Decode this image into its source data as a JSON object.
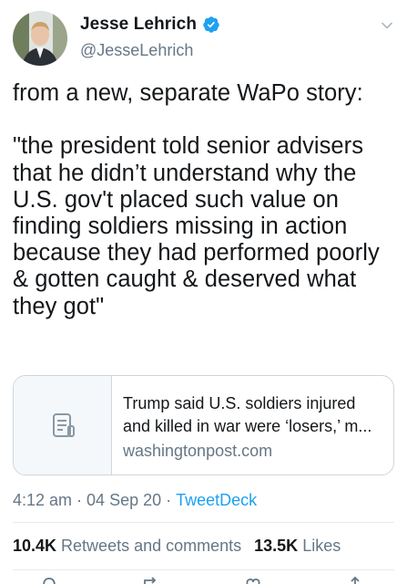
{
  "author": {
    "display_name": "Jesse Lehrich",
    "handle": "@JesseLehrich",
    "avatar_icon": "profile-photo",
    "verified_icon": "verified-badge-icon",
    "verified_color": "#1da1f2"
  },
  "tweet": {
    "text": "from a new, separate WaPo story:\n\n\"the president told senior advisers that he didn’t understand why the U.S. gov't placed such value on finding soldiers missing in action because they had performed poorly & gotten caught & deserved what they got\""
  },
  "link_card": {
    "icon": "document-icon",
    "title": "Trump said U.S. soldiers injured and killed in war were ‘losers,’ m...",
    "domain": "washingtonpost.com"
  },
  "meta": {
    "time": "4:12 am",
    "date": "04 Sep 20",
    "source": "TweetDeck",
    "separator": "·"
  },
  "stats": {
    "retweets_count": "10.4K",
    "retweets_label": "Retweets and comments",
    "likes_count": "13.5K",
    "likes_label": "Likes"
  },
  "colors": {
    "text": "#14171a",
    "secondary": "#657786",
    "accent": "#1da1f2",
    "border": "#ccd6dd"
  },
  "actions": [
    "reply-icon",
    "retweet-icon",
    "like-icon",
    "share-icon"
  ]
}
